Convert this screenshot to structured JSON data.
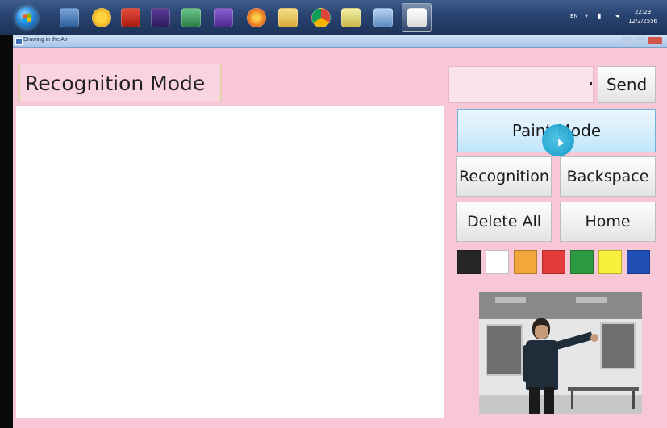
{
  "taskbar": {
    "language": "EN",
    "time": "22:29",
    "date": "12/2/2556"
  },
  "window": {
    "title": "Drawing in the Air"
  },
  "mode": {
    "label": "Recognition Mode"
  },
  "send": {
    "input_value": "",
    "button_label": "Send"
  },
  "buttons": {
    "paint_mode": "Paint Mode",
    "recognition": "Recognition",
    "backspace": "Backspace",
    "delete_all": "Delete All",
    "home": "Home"
  },
  "palette": {
    "colors": [
      "#262626",
      "#ffffff",
      "#f3a73b",
      "#e33a3a",
      "#2e9a3f",
      "#f8ee3c",
      "#1f4fb5"
    ]
  },
  "colors": {
    "window_background": "#f7c7d6",
    "paint_mode_highlight": "#bee6fd",
    "hover_indicator": "#1ea3d1"
  }
}
